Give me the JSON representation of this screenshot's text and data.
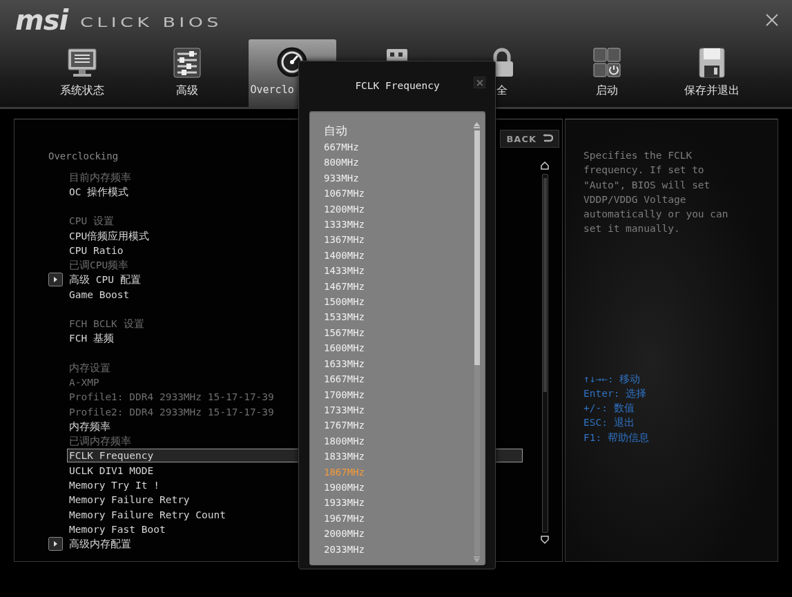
{
  "header": {
    "logo": "msi",
    "product": "CLICK BIOS"
  },
  "tabs": [
    {
      "label": "系统状态",
      "selected": false
    },
    {
      "label": "高级",
      "selected": false
    },
    {
      "label": "Overclo",
      "selected": true
    },
    {
      "selected": false
    },
    {
      "label": "全",
      "selected": false
    },
    {
      "label": "启动",
      "selected": false
    },
    {
      "label": "保存并退出",
      "selected": false
    }
  ],
  "panel": {
    "back_button": "BACK",
    "heading": "Overclocking",
    "groups": [
      {
        "items": [
          {
            "label": "目前内存频率",
            "kind": "info",
            "selected": false
          },
          {
            "label": "OC 操作模式",
            "kind": "setting",
            "selected": false
          }
        ]
      },
      {
        "items": [
          {
            "label": "CPU 设置",
            "kind": "info",
            "selected": false
          },
          {
            "label": "CPU倍频应用模式",
            "kind": "setting",
            "selected": false
          },
          {
            "label": "CPU Ratio",
            "kind": "setting",
            "selected": false
          },
          {
            "label": "已调CPU频率",
            "kind": "info",
            "selected": false
          },
          {
            "label": "高级 CPU 配置",
            "kind": "submenu",
            "selected": false
          },
          {
            "label": "Game Boost",
            "kind": "setting",
            "selected": false
          }
        ]
      },
      {
        "items": [
          {
            "label": "FCH BCLK 设置",
            "kind": "info",
            "selected": false
          },
          {
            "label": "FCH 基频",
            "kind": "setting",
            "selected": false
          }
        ]
      },
      {
        "items": [
          {
            "label": "内存设置",
            "kind": "info",
            "selected": false
          },
          {
            "label": "A-XMP",
            "kind": "info",
            "selected": false
          },
          {
            "label": "Profile1: DDR4 2933MHz 15-17-17-39",
            "kind": "info",
            "selected": false
          },
          {
            "label": "Profile2: DDR4 2933MHz 15-17-17-39",
            "kind": "info",
            "selected": false
          },
          {
            "label": "内存频率",
            "kind": "setting",
            "selected": false
          },
          {
            "label": "已调内存频率",
            "kind": "info",
            "selected": false
          },
          {
            "label": "FCLK Frequency",
            "kind": "setting",
            "selected": true
          },
          {
            "label": "UCLK DIV1 MODE",
            "kind": "setting",
            "selected": false
          },
          {
            "label": "Memory Try It !",
            "kind": "setting",
            "selected": false
          },
          {
            "label": "Memory Failure Retry",
            "kind": "setting",
            "selected": false
          },
          {
            "label": "Memory Failure Retry Count",
            "kind": "setting",
            "selected": false
          },
          {
            "label": "Memory Fast Boot",
            "kind": "setting",
            "selected": false
          },
          {
            "label": "高级内存配置",
            "kind": "submenu",
            "selected": false
          }
        ]
      }
    ]
  },
  "help": {
    "text": "Specifies the FCLK frequency. If set to \"Auto\", BIOS will set VDDP/VDDG Voltage automatically or you can set it manually.",
    "keys": [
      "↑↓→←: 移动",
      "Enter: 选择",
      "+/-: 数值",
      "ESC: 退出",
      "F1: 帮助信息"
    ]
  },
  "dialog": {
    "title": "FCLK Frequency",
    "options": [
      {
        "label": "自动",
        "selected": false
      },
      {
        "label": "667MHz",
        "selected": false
      },
      {
        "label": "800MHz",
        "selected": false
      },
      {
        "label": "933MHz",
        "selected": false
      },
      {
        "label": "1067MHz",
        "selected": false
      },
      {
        "label": "1200MHz",
        "selected": false
      },
      {
        "label": "1333MHz",
        "selected": false
      },
      {
        "label": "1367MHz",
        "selected": false
      },
      {
        "label": "1400MHz",
        "selected": false
      },
      {
        "label": "1433MHz",
        "selected": false
      },
      {
        "label": "1467MHz",
        "selected": false
      },
      {
        "label": "1500MHz",
        "selected": false
      },
      {
        "label": "1533MHz",
        "selected": false
      },
      {
        "label": "1567MHz",
        "selected": false
      },
      {
        "label": "1600MHz",
        "selected": false
      },
      {
        "label": "1633MHz",
        "selected": false
      },
      {
        "label": "1667MHz",
        "selected": false
      },
      {
        "label": "1700MHz",
        "selected": false
      },
      {
        "label": "1733MHz",
        "selected": false
      },
      {
        "label": "1767MHz",
        "selected": false
      },
      {
        "label": "1800MHz",
        "selected": false
      },
      {
        "label": "1833MHz",
        "selected": false
      },
      {
        "label": "1867MHz",
        "selected": true
      },
      {
        "label": "1900MHz",
        "selected": false
      },
      {
        "label": "1933MHz",
        "selected": false
      },
      {
        "label": "1967MHz",
        "selected": false
      },
      {
        "label": "2000MHz",
        "selected": false
      },
      {
        "label": "2033MHz",
        "selected": false
      }
    ]
  }
}
